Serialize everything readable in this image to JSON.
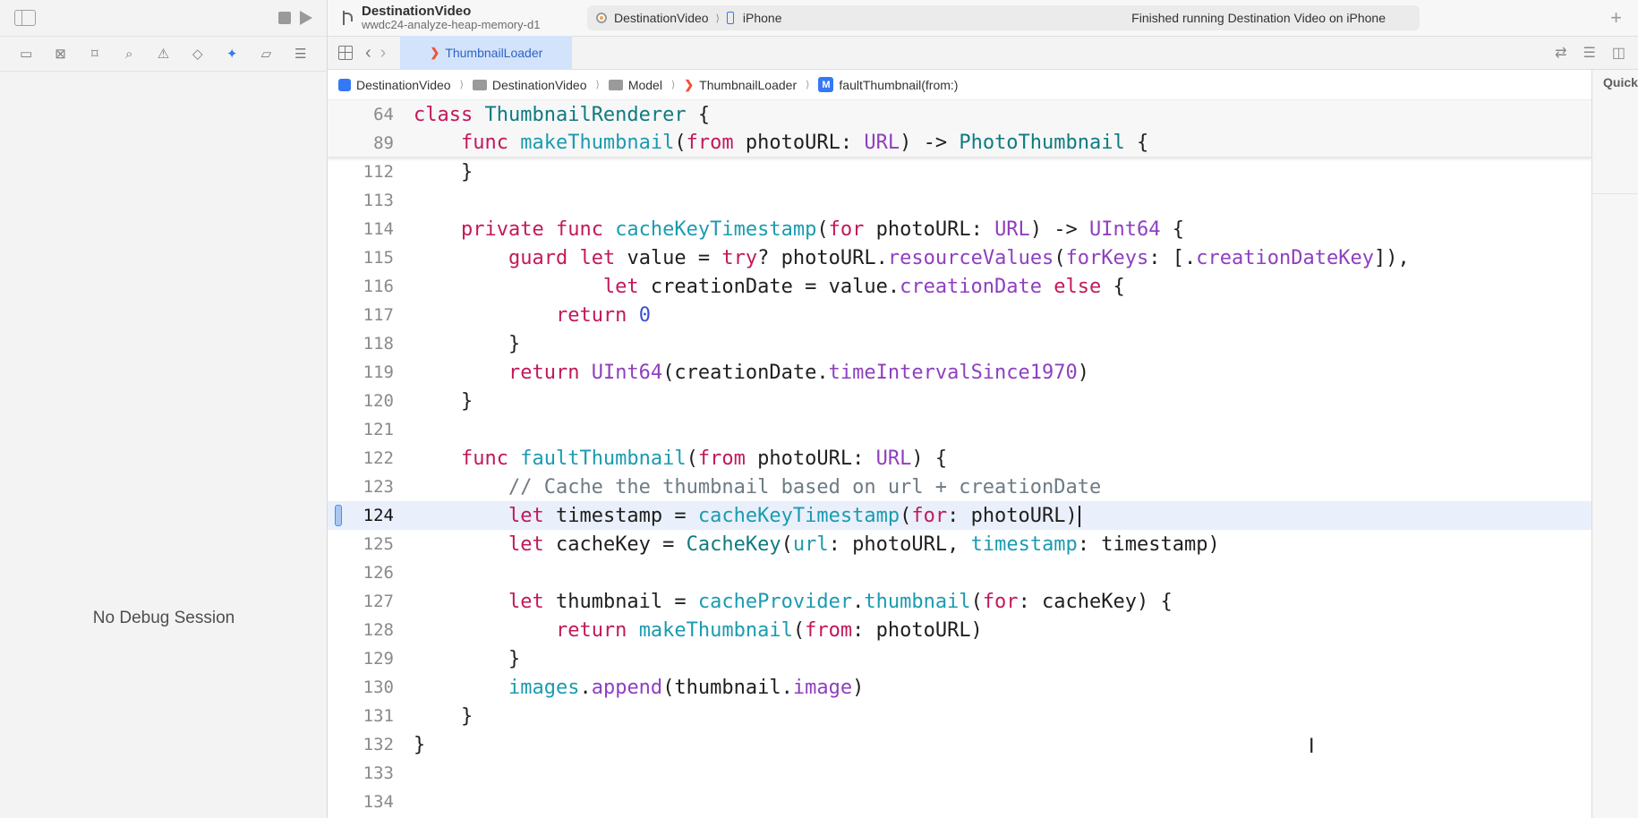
{
  "toolbar": {
    "project_name": "DestinationVideo",
    "branch_name": "wwdc24-analyze-heap-memory-d1",
    "scheme": "DestinationVideo",
    "scheme_sep": "⟩",
    "device": "iPhone",
    "status": "Finished running Destination Video on iPhone",
    "add_label": "+"
  },
  "tab": {
    "label": "ThumbnailLoader"
  },
  "breadcrumb": {
    "items": [
      "DestinationVideo",
      "DestinationVideo",
      "Model",
      "ThumbnailLoader",
      "faultThumbnail(from:)"
    ],
    "sep": "⟩"
  },
  "debug": {
    "no_session": "No Debug Session"
  },
  "inspector": {
    "label": "Quick"
  },
  "icons": {
    "m_symbol": "M",
    "swift_glyph": "❯",
    "back": "‹",
    "forward": "›"
  },
  "colors": {
    "accent": "#3478f6",
    "highlight_line": "#e9f0fb"
  },
  "code": {
    "lines": [
      {
        "num": "64",
        "tokens": [
          [
            "kw",
            "class"
          ],
          [
            "p",
            " "
          ],
          [
            "ty",
            "ThumbnailRenderer"
          ],
          [
            "p",
            " {"
          ]
        ]
      },
      {
        "num": "89",
        "tokens": [
          [
            "p",
            "    "
          ],
          [
            "kw",
            "func"
          ],
          [
            "p",
            " "
          ],
          [
            "fn",
            "makeThumbnail"
          ],
          [
            "p",
            "("
          ],
          [
            "kw",
            "from"
          ],
          [
            "p",
            " photoURL: "
          ],
          [
            "mb",
            "URL"
          ],
          [
            "p",
            ") -> "
          ],
          [
            "ty",
            "PhotoThumbnail"
          ],
          [
            "p",
            " {"
          ]
        ]
      },
      {
        "num": "112",
        "tokens": [
          [
            "p",
            "    }"
          ]
        ]
      },
      {
        "num": "113",
        "tokens": []
      },
      {
        "num": "114",
        "tokens": [
          [
            "p",
            "    "
          ],
          [
            "kw",
            "private"
          ],
          [
            "p",
            " "
          ],
          [
            "kw",
            "func"
          ],
          [
            "p",
            " "
          ],
          [
            "fn",
            "cacheKeyTimestamp"
          ],
          [
            "p",
            "("
          ],
          [
            "kw",
            "for"
          ],
          [
            "p",
            " photoURL: "
          ],
          [
            "mb",
            "URL"
          ],
          [
            "p",
            ") -> "
          ],
          [
            "mb",
            "UInt64"
          ],
          [
            "p",
            " {"
          ]
        ]
      },
      {
        "num": "115",
        "tokens": [
          [
            "p",
            "        "
          ],
          [
            "kw",
            "guard"
          ],
          [
            "p",
            " "
          ],
          [
            "kw",
            "let"
          ],
          [
            "p",
            " value = "
          ],
          [
            "kw",
            "try"
          ],
          [
            "p",
            "? photoURL."
          ],
          [
            "mb",
            "resourceValues"
          ],
          [
            "p",
            "("
          ],
          [
            "mb",
            "forKeys"
          ],
          [
            "p",
            ": [."
          ],
          [
            "mb",
            "creationDateKey"
          ],
          [
            "p",
            "]),"
          ]
        ]
      },
      {
        "num": "116",
        "tokens": [
          [
            "p",
            "                "
          ],
          [
            "kw",
            "let"
          ],
          [
            "p",
            " creationDate = value."
          ],
          [
            "mb",
            "creationDate"
          ],
          [
            "p",
            " "
          ],
          [
            "kw",
            "else"
          ],
          [
            "p",
            " {"
          ]
        ]
      },
      {
        "num": "117",
        "tokens": [
          [
            "p",
            "            "
          ],
          [
            "kw",
            "return"
          ],
          [
            "p",
            " "
          ],
          [
            "num",
            "0"
          ]
        ]
      },
      {
        "num": "118",
        "tokens": [
          [
            "p",
            "        }"
          ]
        ]
      },
      {
        "num": "119",
        "tokens": [
          [
            "p",
            "        "
          ],
          [
            "kw",
            "return"
          ],
          [
            "p",
            " "
          ],
          [
            "mb",
            "UInt64"
          ],
          [
            "p",
            "(creationDate."
          ],
          [
            "mb",
            "timeIntervalSince1970"
          ],
          [
            "p",
            ")"
          ]
        ]
      },
      {
        "num": "120",
        "tokens": [
          [
            "p",
            "    }"
          ]
        ]
      },
      {
        "num": "121",
        "tokens": []
      },
      {
        "num": "122",
        "tokens": [
          [
            "p",
            "    "
          ],
          [
            "kw",
            "func"
          ],
          [
            "p",
            " "
          ],
          [
            "fn",
            "faultThumbnail"
          ],
          [
            "p",
            "("
          ],
          [
            "kw",
            "from"
          ],
          [
            "p",
            " photoURL: "
          ],
          [
            "mb",
            "URL"
          ],
          [
            "p",
            ") {"
          ]
        ]
      },
      {
        "num": "123",
        "tokens": [
          [
            "p",
            "        "
          ],
          [
            "cm",
            "// Cache the thumbnail based on url + creationDate"
          ]
        ]
      },
      {
        "num": "124",
        "tokens": [
          [
            "p",
            "        "
          ],
          [
            "kw",
            "let"
          ],
          [
            "p",
            " timestamp = "
          ],
          [
            "fn",
            "cacheKeyTimestamp"
          ],
          [
            "p",
            "("
          ],
          [
            "kw",
            "for"
          ],
          [
            "p",
            ": photoURL)"
          ]
        ]
      },
      {
        "num": "125",
        "tokens": [
          [
            "p",
            "        "
          ],
          [
            "kw",
            "let"
          ],
          [
            "p",
            " cacheKey = "
          ],
          [
            "ty",
            "CacheKey"
          ],
          [
            "p",
            "("
          ],
          [
            "fn",
            "url"
          ],
          [
            "p",
            ": photoURL, "
          ],
          [
            "fn",
            "timestamp"
          ],
          [
            "p",
            ": timestamp)"
          ]
        ]
      },
      {
        "num": "126",
        "tokens": []
      },
      {
        "num": "127",
        "tokens": [
          [
            "p",
            "        "
          ],
          [
            "kw",
            "let"
          ],
          [
            "p",
            " thumbnail = "
          ],
          [
            "fn",
            "cacheProvider"
          ],
          [
            "p",
            "."
          ],
          [
            "fn",
            "thumbnail"
          ],
          [
            "p",
            "("
          ],
          [
            "kw",
            "for"
          ],
          [
            "p",
            ": cacheKey) {"
          ]
        ]
      },
      {
        "num": "128",
        "tokens": [
          [
            "p",
            "            "
          ],
          [
            "kw",
            "return"
          ],
          [
            "p",
            " "
          ],
          [
            "fn",
            "makeThumbnail"
          ],
          [
            "p",
            "("
          ],
          [
            "kw",
            "from"
          ],
          [
            "p",
            ": photoURL)"
          ]
        ]
      },
      {
        "num": "129",
        "tokens": [
          [
            "p",
            "        }"
          ]
        ]
      },
      {
        "num": "130",
        "tokens": [
          [
            "p",
            "        "
          ],
          [
            "fn",
            "images"
          ],
          [
            "p",
            "."
          ],
          [
            "mb",
            "append"
          ],
          [
            "p",
            "(thumbnail."
          ],
          [
            "mb",
            "image"
          ],
          [
            "p",
            ")"
          ]
        ]
      },
      {
        "num": "131",
        "tokens": [
          [
            "p",
            "    }"
          ]
        ]
      },
      {
        "num": "132",
        "tokens": [
          [
            "p",
            "}"
          ]
        ]
      },
      {
        "num": "133",
        "tokens": []
      },
      {
        "num": "134",
        "tokens": []
      }
    ]
  }
}
